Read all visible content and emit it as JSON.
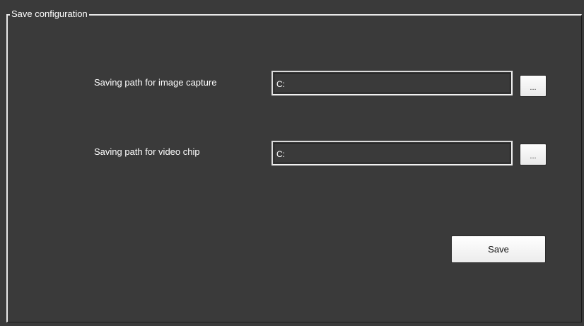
{
  "groupbox": {
    "title": "Save configuration"
  },
  "image_capture": {
    "label": "Saving path for image capture",
    "path_value": "C:",
    "browse_label": "..."
  },
  "video_chip": {
    "label": "Saving path for video chip",
    "path_value": "C:",
    "browse_label": "..."
  },
  "actions": {
    "save_label": "Save"
  },
  "colors": {
    "panel_background": "#3a3a3a",
    "text": "#ffffff",
    "button_face": "#f0f0f0"
  }
}
